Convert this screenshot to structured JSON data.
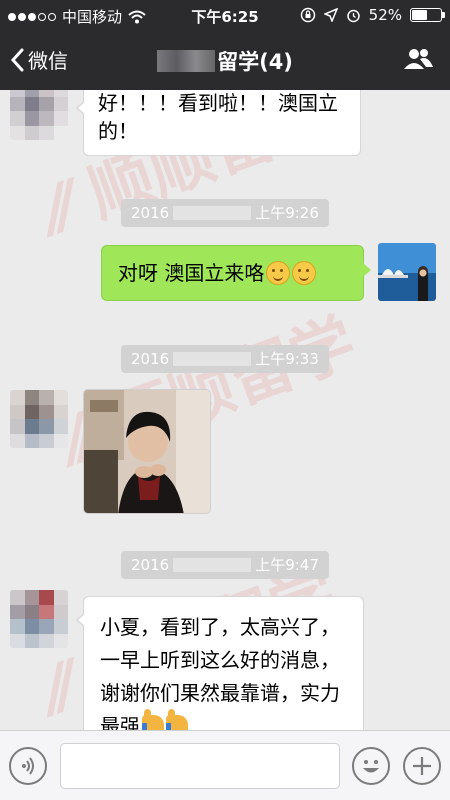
{
  "status_bar": {
    "carrier": "中国移动",
    "time": "下午6:25",
    "battery": "52%",
    "battery_level": 0.52,
    "icons": [
      "wifi-icon",
      "lock-rotation-icon",
      "location-icon",
      "alarm-icon"
    ]
  },
  "nav": {
    "back_label": "微信",
    "title": "留学(4)",
    "back_icon": "chevron-left-icon",
    "right_icon": "contacts-icon"
  },
  "messages": {
    "m1_text": "好！！！看到啦！！澳国立的！",
    "ts1_prefix": "2016",
    "ts1_time": "上午9:26",
    "m2_text": "对呀 澳国立来咯",
    "ts2_prefix": "2016",
    "ts2_time": "上午9:33",
    "ts3_prefix": "2016",
    "ts3_time": "上午9:47",
    "m4_text": "小夏，看到了，太高兴了，一早上听到这么好的消息，谢谢你们果然最靠谱，实力最强"
  },
  "colors": {
    "bar": "#2b2b2e",
    "chat_bg": "#ebebeb",
    "green_bubble": "#9fe759",
    "timestamp_bg": "#d2d2d2"
  },
  "input_bar": {
    "voice_icon": "voice-icon",
    "emoji_icon": "emoji-icon",
    "plus_icon": "plus-icon"
  }
}
